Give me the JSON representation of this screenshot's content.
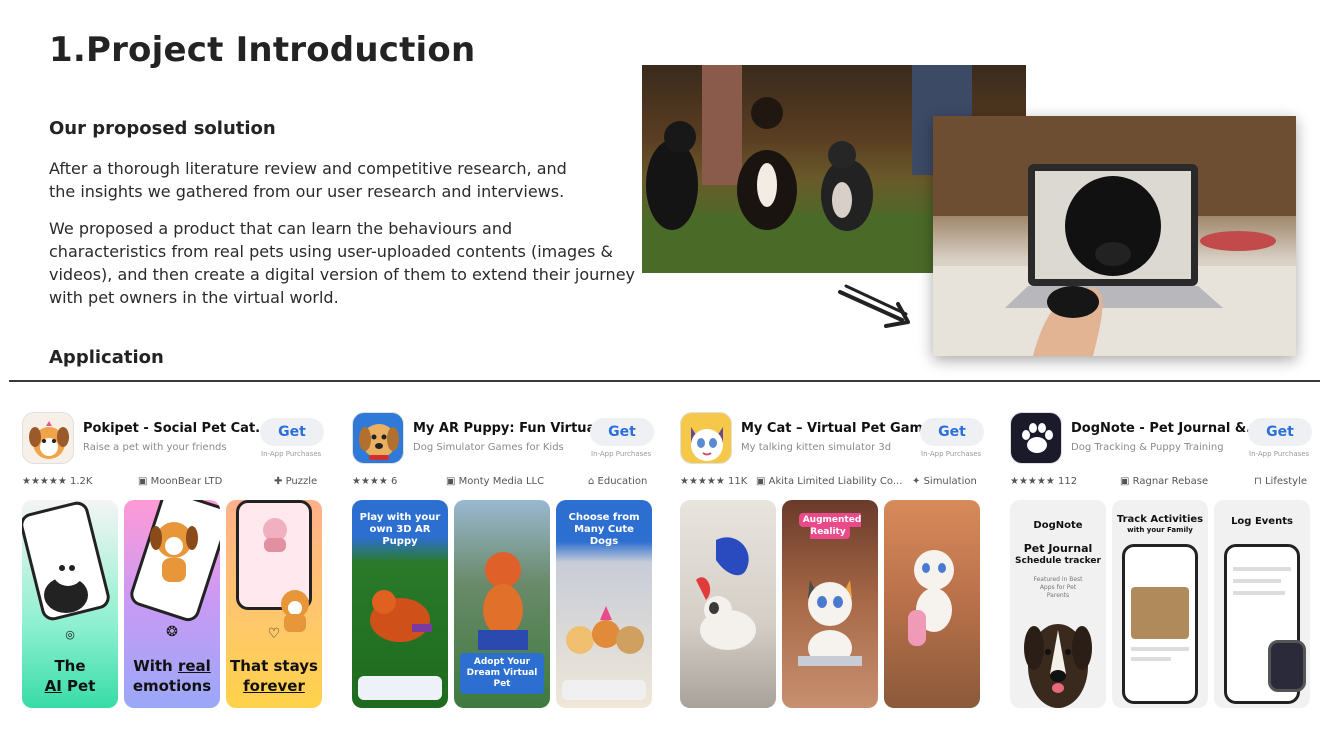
{
  "header": {
    "title": "1.Project Introduction"
  },
  "solution": {
    "heading": "Our proposed solution",
    "para1_line1": "After a thorough literature review and competitive research, and",
    "para1_line2": "the insights we gathered from our user research and interviews.",
    "para2_line1": "We proposed a product that can learn the behaviours and",
    "para2_line2": "characteristics from real pets using user-uploaded contents (images &",
    "para2_line3": "videos), and then create a digital version of them to extend their journey",
    "para2_line4": "with pet owners in the virtual world."
  },
  "application": {
    "heading": "Application"
  },
  "apps": [
    {
      "name": "Pokipet - Social Pet Cat...",
      "subtitle": "Raise a pet with your friends",
      "get": "Get",
      "iap": "In-App Purchases",
      "rating": "★★★★★ 1.2K",
      "developer": "MoonBear LTD",
      "category": "Puzzle",
      "shots": [
        "The AI Pet",
        "With real emotions",
        "That stays forever"
      ],
      "shot_parts": {
        "the": "The",
        "ai": "AI",
        "pet": "Pet",
        "with": "With",
        "real": "real",
        "emotions": "emotions",
        "that_stays": "That stays",
        "forever": "forever"
      },
      "colors": {
        "icon_bg": "#f6f0e8",
        "s1": "#49e2b0",
        "s2": "#b48cf0",
        "s3": "#ffbf5a"
      }
    },
    {
      "name": "My AR Puppy: Fun Virtual...",
      "subtitle": "Dog Simulator Games for Kids",
      "get": "Get",
      "iap": "In-App Purchases",
      "rating": "★★★★ 6",
      "developer": "Monty Media LLC",
      "category": "Education",
      "shot1_text": "Play with your own 3D AR Puppy",
      "shot2_text": "Adopt Your Dream Virtual Pet",
      "shot3_text": "Choose from Many Cute Dogs",
      "colors": {
        "icon_bg": "#2f7ad8",
        "s1": "#2d6fd0",
        "s2": "#3b7fdc",
        "s3": "#2d6fd0"
      }
    },
    {
      "name": "My Cat – Virtual Pet Games",
      "subtitle": "My talking kitten simulator 3d",
      "get": "Get",
      "iap": "In-App Purchases",
      "rating": "★★★★★ 11K",
      "developer": "Akita Limited Liability Co...",
      "category": "Simulation",
      "shot2_badge": "Augmented Reality",
      "colors": {
        "icon_bg": "#f5c84a",
        "s1": "#d9d4cc",
        "s2": "#7a4a3a",
        "s3": "#a86a48"
      }
    },
    {
      "name": "DogNote - Pet Journal &...",
      "subtitle": "Dog Tracking & Puppy Training",
      "get": "Get",
      "iap": "In-App Purchases",
      "rating": "★★★★★ 112",
      "developer": "Ragnar Rebase",
      "category": "Lifestyle",
      "shot1_brand": "DogNote",
      "shot1_title": "Pet Journal",
      "shot1_sub": "Schedule tracker",
      "shot1_feat": "Featured in Best Apps for Pet Parents",
      "shot2_title": "Track Activities",
      "shot2_sub": "with your Family",
      "shot3_title": "Log Events",
      "colors": {
        "icon_bg": "#1a1a2a",
        "s1": "#f1f1f1",
        "s2": "#f1f1f1",
        "s3": "#f1f1f1"
      }
    }
  ]
}
